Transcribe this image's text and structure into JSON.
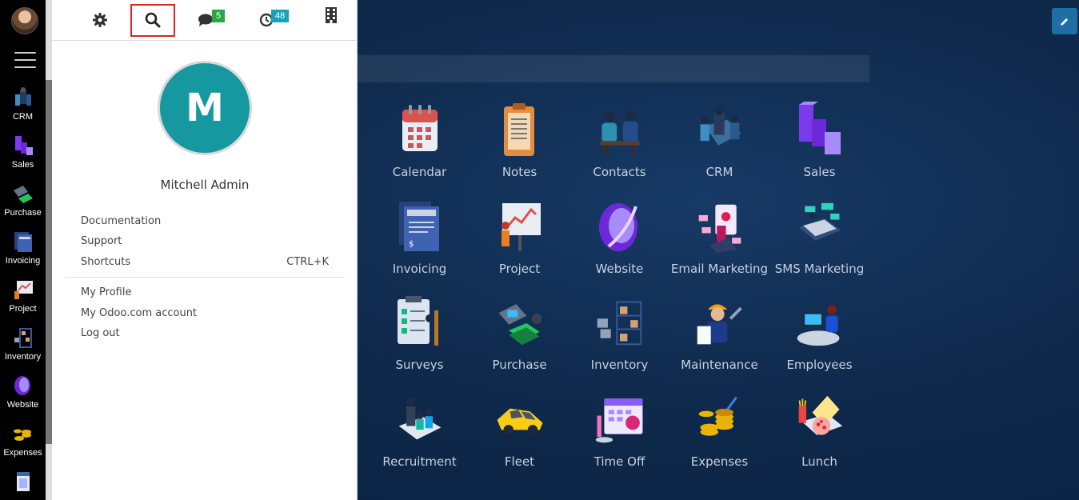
{
  "topbar": {
    "messages_count": "5",
    "activities_count": "48",
    "colors": {
      "messages_badge": "#28a745",
      "activities_badge": "#17a2b8",
      "search_highlight": "#d62828"
    }
  },
  "user": {
    "initial": "M",
    "name": "Mitchell Admin",
    "avatar_color": "#1698a0"
  },
  "user_menu": {
    "group1": [
      {
        "label": "Documentation",
        "shortcut": ""
      },
      {
        "label": "Support",
        "shortcut": ""
      },
      {
        "label": "Shortcuts",
        "shortcut": "CTRL+K"
      }
    ],
    "group2": [
      {
        "label": "My Profile"
      },
      {
        "label": "My Odoo.com account"
      },
      {
        "label": "Log out"
      }
    ]
  },
  "sidebar_apps": [
    "CRM",
    "Sales",
    "Purchase",
    "Invoicing",
    "Project",
    "Inventory",
    "Website",
    "Expenses"
  ],
  "apps": [
    {
      "label": "Calendar",
      "icon": "calendar-icon"
    },
    {
      "label": "Notes",
      "icon": "notes-icon"
    },
    {
      "label": "Contacts",
      "icon": "contacts-icon"
    },
    {
      "label": "CRM",
      "icon": "crm-icon"
    },
    {
      "label": "Sales",
      "icon": "sales-icon"
    },
    {
      "label": "Invoicing",
      "icon": "invoicing-icon"
    },
    {
      "label": "Project",
      "icon": "project-icon"
    },
    {
      "label": "Website",
      "icon": "website-icon"
    },
    {
      "label": "Email Marketing",
      "icon": "email-marketing-icon"
    },
    {
      "label": "SMS Marketing",
      "icon": "sms-marketing-icon"
    },
    {
      "label": "Surveys",
      "icon": "surveys-icon"
    },
    {
      "label": "Purchase",
      "icon": "purchase-icon"
    },
    {
      "label": "Inventory",
      "icon": "inventory-icon"
    },
    {
      "label": "Maintenance",
      "icon": "maintenance-icon"
    },
    {
      "label": "Employees",
      "icon": "employees-icon"
    },
    {
      "label": "Recruitment",
      "icon": "recruitment-icon"
    },
    {
      "label": "Fleet",
      "icon": "fleet-icon"
    },
    {
      "label": "Time Off",
      "icon": "time-off-icon"
    },
    {
      "label": "Expenses",
      "icon": "expenses-icon"
    },
    {
      "label": "Lunch",
      "icon": "lunch-icon"
    }
  ]
}
